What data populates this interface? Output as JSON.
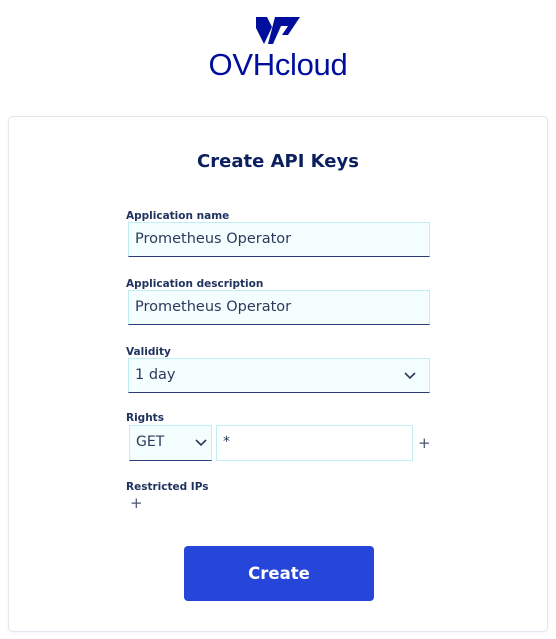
{
  "brand": {
    "name": "OVHcloud",
    "color": "#000e9c",
    "logo_icon": "ovhcloud-logo-icon"
  },
  "form": {
    "title": "Create API Keys",
    "application_name": {
      "label": "Application name",
      "value": "Prometheus Operator"
    },
    "application_description": {
      "label": "Application description",
      "value": "Prometheus Operator"
    },
    "validity": {
      "label": "Validity",
      "selected": "1 day"
    },
    "rights": {
      "label": "Rights",
      "method": "GET",
      "path": "*"
    },
    "restricted_ips": {
      "label": "Restricted IPs"
    },
    "add_icon": "plus-icon",
    "submit_label": "Create",
    "accent_color": "#2546d8"
  }
}
